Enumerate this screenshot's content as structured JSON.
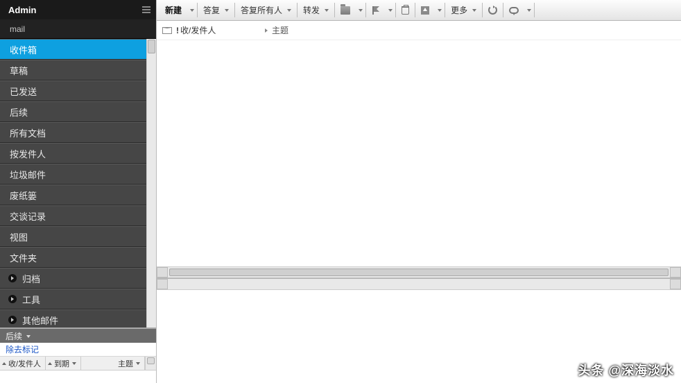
{
  "sidebar": {
    "header": "Admin",
    "account": "mail",
    "folders": [
      {
        "label": "收件箱",
        "selected": true
      },
      {
        "label": "草稿"
      },
      {
        "label": "已发送"
      },
      {
        "label": "后续"
      },
      {
        "label": "所有文档"
      },
      {
        "label": "按发件人"
      },
      {
        "label": "垃圾邮件"
      },
      {
        "label": "废纸篓"
      },
      {
        "label": "交谈记录"
      },
      {
        "label": "视图"
      },
      {
        "label": "文件夹"
      },
      {
        "label": "归档",
        "expandable": true
      },
      {
        "label": "工具",
        "expandable": true
      },
      {
        "label": "其他邮件",
        "expandable": true
      }
    ],
    "bottom": {
      "header": "后续",
      "link": "除去标记",
      "filters": {
        "sender": "收/发件人",
        "due": "到期",
        "subject": "主题"
      }
    }
  },
  "toolbar": {
    "new": "新建",
    "reply": "答复",
    "reply_all": "答复所有人",
    "forward": "转发",
    "more": "更多"
  },
  "columns": {
    "sender": "收/发件人",
    "subject": "主题"
  },
  "watermark": "头条 @深海淡水"
}
